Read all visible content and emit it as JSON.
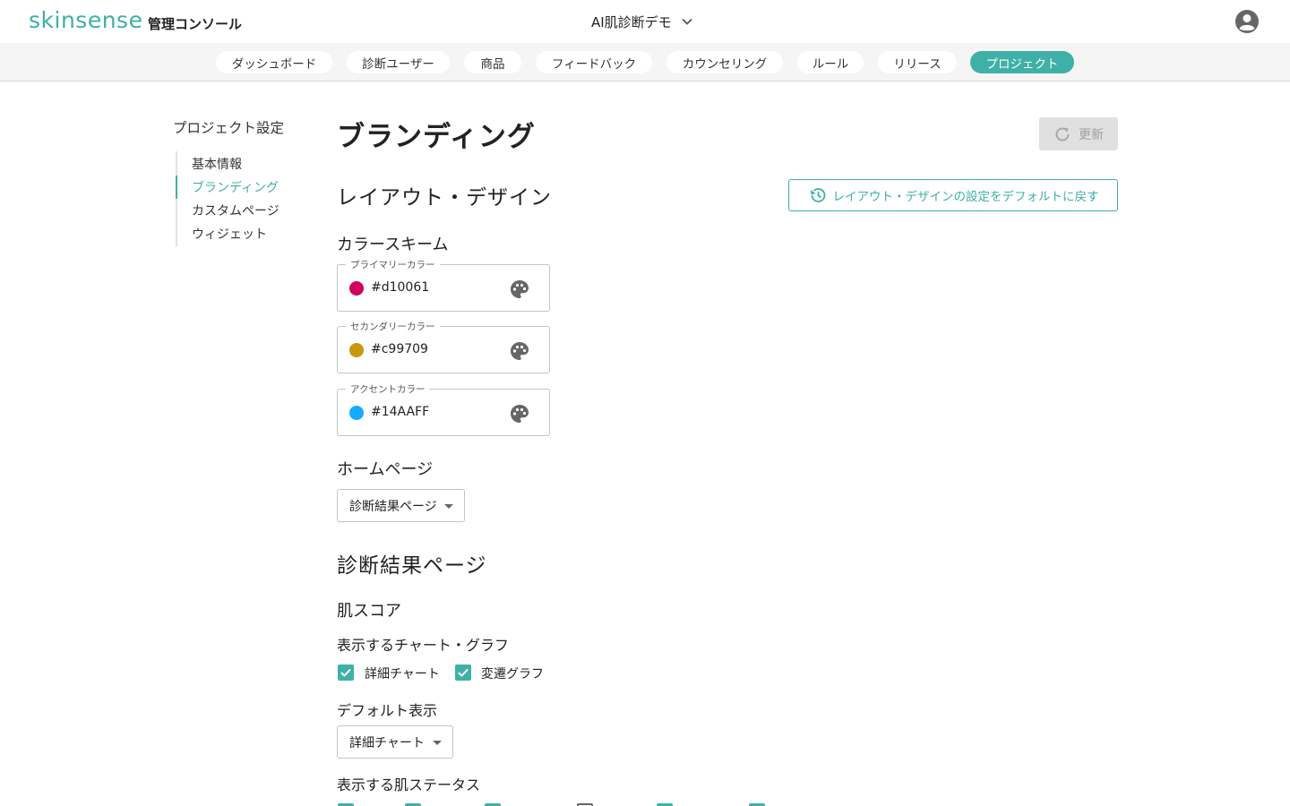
{
  "header": {
    "logo": "skinsense",
    "logo_sub": "管理コンソール",
    "project_name": "AI肌診断デモ"
  },
  "nav": {
    "items": [
      {
        "label": "ダッシュボード",
        "active": false
      },
      {
        "label": "診断ユーザー",
        "active": false
      },
      {
        "label": "商品",
        "active": false
      },
      {
        "label": "フィードバック",
        "active": false
      },
      {
        "label": "カウンセリング",
        "active": false
      },
      {
        "label": "ルール",
        "active": false
      },
      {
        "label": "リリース",
        "active": false
      },
      {
        "label": "プロジェクト",
        "active": true
      }
    ]
  },
  "sidebar": {
    "title": "プロジェクト設定",
    "items": [
      {
        "label": "基本情報",
        "active": false
      },
      {
        "label": "ブランディング",
        "active": true
      },
      {
        "label": "カスタムページ",
        "active": false
      },
      {
        "label": "ウィジェット",
        "active": false
      }
    ]
  },
  "main": {
    "title": "ブランディング",
    "update_label": "更新",
    "layout_section": "レイアウト・デザイン",
    "reset_label": "レイアウト・デザインの設定をデフォルトに戻す",
    "color_scheme": {
      "heading": "カラースキーム",
      "fields": [
        {
          "label": "プライマリーカラー",
          "value": "#d10061",
          "color": "#d10061"
        },
        {
          "label": "セカンダリーカラー",
          "value": "#c99709",
          "color": "#c99709"
        },
        {
          "label": "アクセントカラー",
          "value": "#14AAFF",
          "color": "#14AAFF"
        }
      ]
    },
    "homepage": {
      "heading": "ホームページ",
      "selected": "診断結果ページ"
    },
    "result_section": "診断結果ページ",
    "skin_score": {
      "heading": "肌スコア",
      "charts_heading": "表示するチャート・グラフ",
      "charts": [
        {
          "label": "詳細チャート",
          "checked": true
        },
        {
          "label": "変遷グラフ",
          "checked": true
        }
      ],
      "default_heading": "デフォルト表示",
      "default_selected": "詳細チャート",
      "status_heading": "表示する肌ステータス"
    }
  },
  "colors": {
    "accent": "#3fb0a7"
  }
}
